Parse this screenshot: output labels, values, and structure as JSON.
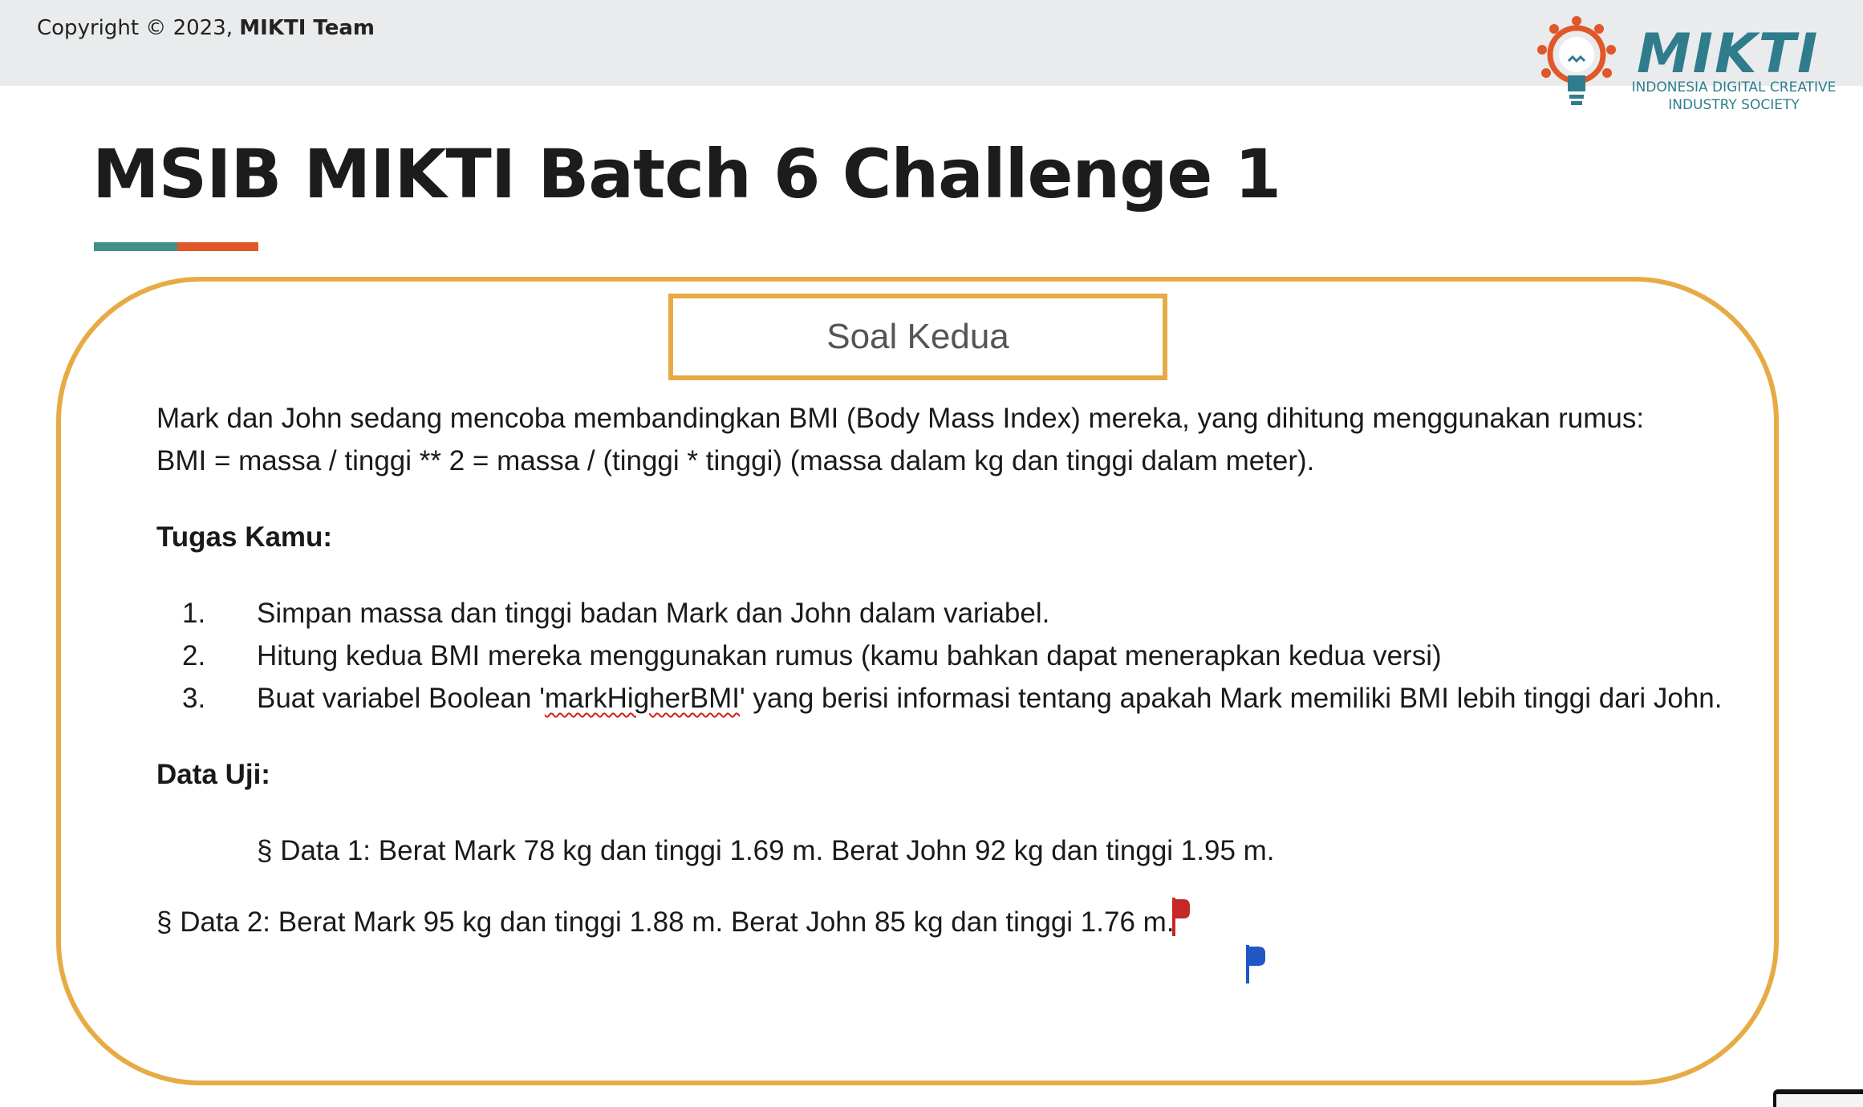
{
  "header": {
    "copyright_prefix": "Copyright © 2023,",
    "copyright_team": "MIKTI Team"
  },
  "logo": {
    "word": "MIKTI",
    "subtitle_line1": "INDONESIA DIGITAL CREATIVE",
    "subtitle_line2": "INDUSTRY SOCIETY",
    "icon": "lightbulb-gear-icon"
  },
  "slide": {
    "title": "MSIB MIKTI Batch 6 Challenge 1",
    "section_label": "Soal Kedua",
    "intro_line1": "Mark dan John sedang mencoba membandingkan BMI (Body Mass Index) mereka, yang dihitung menggunakan rumus:",
    "intro_line2": "BMI = massa / tinggi ** 2 = massa / (tinggi * tinggi) (massa dalam kg dan tinggi dalam meter).",
    "tasks_heading": "Tugas Kamu:",
    "tasks": [
      {
        "num": "1.",
        "text": "Simpan massa dan tinggi badan Mark dan John dalam variabel."
      },
      {
        "num": "2.",
        "text": "Hitung kedua BMI mereka menggunakan rumus (kamu bahkan dapat menerapkan kedua versi)"
      },
      {
        "num": "3.",
        "text_before": "Buat variabel Boolean '",
        "text_code": "markHigherBMI",
        "text_after": "' yang berisi informasi tentang apakah Mark memiliki BMI lebih tinggi dari John."
      }
    ],
    "test_heading": "Data Uji:",
    "data1": "§ Data 1: Berat Mark 78 kg dan tinggi 1.69 m. Berat John 92 kg dan tinggi 1.95 m.",
    "data2_before": "§ Data 2: Berat Mark 95 kg dan tinggi 1.88 m. Berat John 85 kg dan tinggi 1.7",
    "data2_hidden_digit": "6",
    "data2_after": " m."
  },
  "colors": {
    "accent_teal": "#3e9089",
    "accent_orange": "#e0582a",
    "card_border": "#e7ab45",
    "logo_teal": "#2f7d8c",
    "flag_red": "#c62828",
    "flag_blue": "#1f57c3"
  }
}
